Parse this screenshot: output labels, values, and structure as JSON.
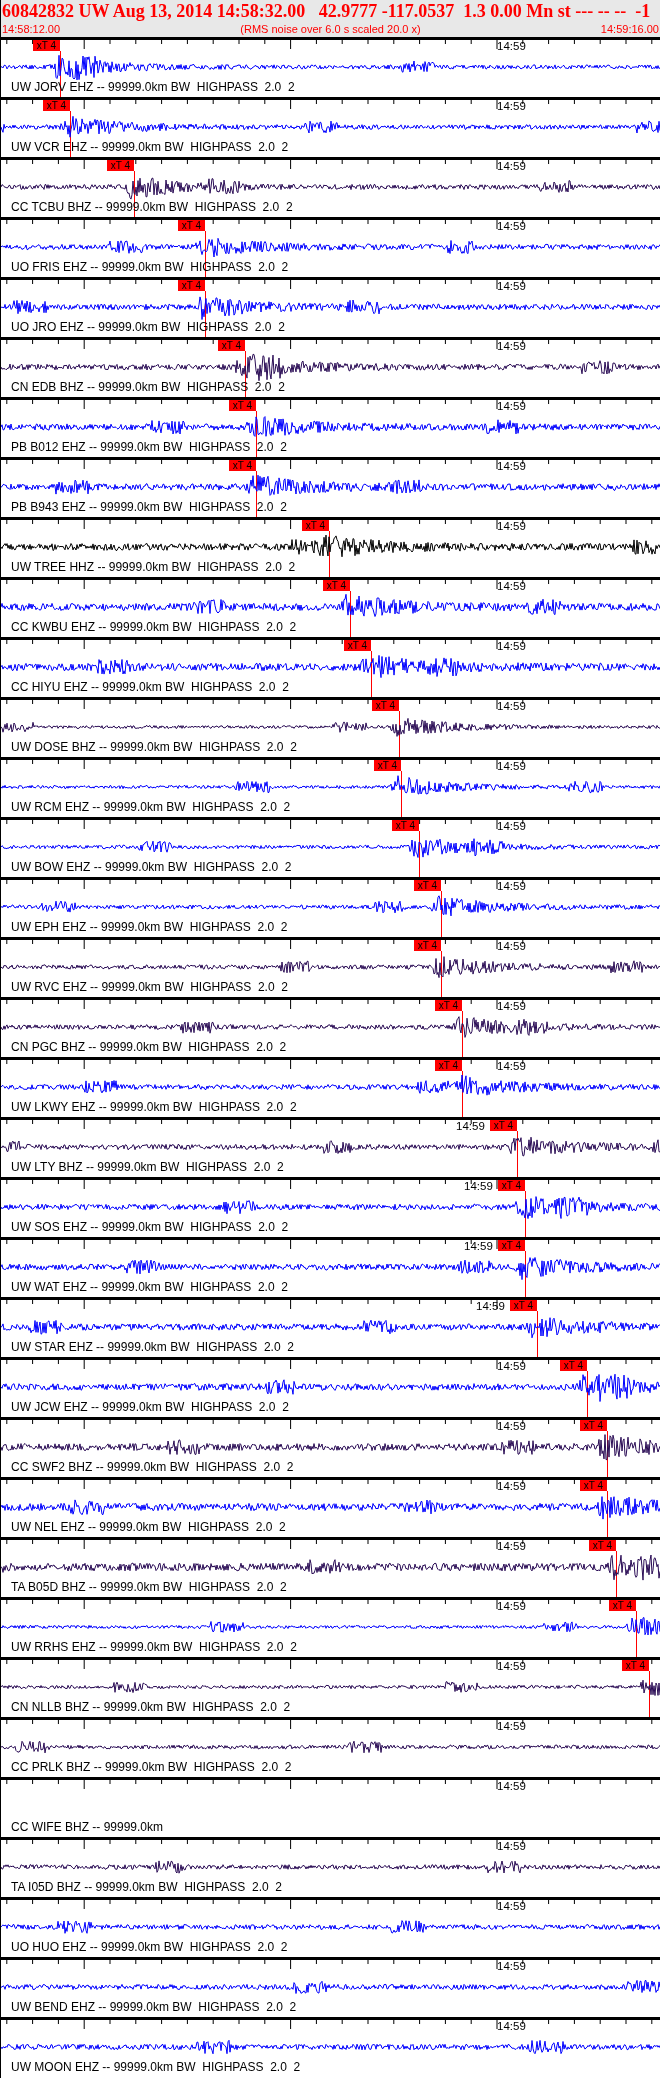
{
  "header": {
    "title": "60842832 UW Aug 13, 2014 14:58:32.00   42.9777 -117.0537  1.3 0.00 Mn st --- -- --  -1",
    "start_time": "14:58:12.00",
    "note": "(RMS noise over 6.0 s scaled 20.0 x)",
    "end_time": "14:59:16.00"
  },
  "traces": [
    {
      "label": "UW JORV EHZ -- 99999.0km BW  HIGHPASS  2.0  2",
      "time_mark": "14:59",
      "color": "#0000ff",
      "pick": {
        "label": "xT 4"
      }
    },
    {
      "label": "UW VCR EHZ -- 99999.0km BW  HIGHPASS  2.0  2",
      "time_mark": "14:59",
      "color": "#0000ff",
      "pick": {
        "label": "xT 4"
      }
    },
    {
      "label": "CC TCBU BHZ -- 99999.0km BW  HIGHPASS  2.0  2",
      "time_mark": "14:59",
      "color": "#2a0c55",
      "pick": {
        "label": "xT 4"
      }
    },
    {
      "label": "UO FRIS EHZ -- 99999.0km BW  HIGHPASS  2.0  2",
      "time_mark": "14:59",
      "color": "#0000ff",
      "pick": {
        "label": "xT 4"
      }
    },
    {
      "label": "UO JRO EHZ -- 99999.0km BW  HIGHPASS  2.0  2",
      "time_mark": "14:59",
      "color": "#0000ff",
      "pick": {
        "label": "xT 4"
      }
    },
    {
      "label": "CN EDB BHZ -- 99999.0km BW  HIGHPASS  2.0  2",
      "time_mark": "14:59",
      "color": "#2a0c55",
      "pick": {
        "label": "xT 4"
      }
    },
    {
      "label": "PB B012 EHZ -- 99999.0km BW  HIGHPASS  2.0  2",
      "time_mark": "14:59",
      "color": "#0000ff",
      "pick": {
        "label": "xT 4"
      }
    },
    {
      "label": "PB B943 EHZ -- 99999.0km BW  HIGHPASS  2.0  2",
      "time_mark": "14:59",
      "color": "#0000ff",
      "pick": {
        "label": "xT 4"
      }
    },
    {
      "label": "UW TREE HHZ -- 99999.0km BW  HIGHPASS  2.0  2",
      "time_mark": "14:59",
      "color": "#000000",
      "pick": {
        "label": "xT 4"
      }
    },
    {
      "label": "CC KWBU EHZ -- 99999.0km BW  HIGHPASS  2.0  2",
      "time_mark": "14:59",
      "color": "#0000ff",
      "pick": {
        "label": "xT 4"
      }
    },
    {
      "label": "CC HIYU EHZ -- 99999.0km BW  HIGHPASS  2.0  2",
      "time_mark": "14:59",
      "color": "#0000ff",
      "pick": {
        "label": "xT 4"
      }
    },
    {
      "label": "UW DOSE BHZ -- 99999.0km BW  HIGHPASS  2.0  2",
      "time_mark": "14:59",
      "color": "#2a0c55",
      "pick": {
        "label": "xT 4"
      }
    },
    {
      "label": "UW RCM EHZ -- 99999.0km BW  HIGHPASS  2.0  2",
      "time_mark": "14:59",
      "color": "#0000ff",
      "pick": {
        "label": "xT 4"
      }
    },
    {
      "label": "UW BOW EHZ -- 99999.0km BW  HIGHPASS  2.0  2",
      "time_mark": "14:59",
      "color": "#0000ff",
      "pick": {
        "label": "xT 4"
      }
    },
    {
      "label": "UW EPH EHZ -- 99999.0km BW  HIGHPASS  2.0  2",
      "time_mark": "14:59",
      "color": "#0000ff",
      "pick": {
        "label": "xT 4"
      }
    },
    {
      "label": "UW RVC EHZ -- 99999.0km BW  HIGHPASS  2.0  2",
      "time_mark": "14:59",
      "color": "#2a0c55",
      "pick": {
        "label": "xT 4"
      }
    },
    {
      "label": "CN PGC BHZ -- 99999.0km BW  HIGHPASS  2.0  2",
      "time_mark": "14:59",
      "color": "#2a0c55",
      "pick": {
        "label": "xT 4"
      }
    },
    {
      "label": "UW LKWY EHZ -- 99999.0km BW  HIGHPASS  2.0  2",
      "time_mark": "14:59",
      "color": "#0000ff",
      "pick": {
        "label": "xT 4"
      }
    },
    {
      "label": "UW LTY BHZ -- 99999.0km BW  HIGHPASS  2.0  2",
      "time_mark": "14:59",
      "color": "#2a0c55",
      "pick": {
        "label": "xT 4"
      }
    },
    {
      "label": "UW SOS EHZ -- 99999.0km BW  HIGHPASS  2.0  2",
      "time_mark": "14:59",
      "color": "#0000ff",
      "pick": {
        "label": "xT 4"
      }
    },
    {
      "label": "UW WAT EHZ -- 99999.0km BW  HIGHPASS  2.0  2",
      "time_mark": "14:59",
      "color": "#0000ff",
      "pick": {
        "label": "xT 4"
      }
    },
    {
      "label": "UW STAR EHZ -- 99999.0km BW  HIGHPASS  2.0  2",
      "time_mark": "14:59",
      "color": "#0000ff",
      "pick": {
        "label": "xT 4"
      }
    },
    {
      "label": "UW JCW EHZ -- 99999.0km BW  HIGHPASS  2.0  2",
      "time_mark": "14:59",
      "color": "#0000ff",
      "pick": {
        "label": "xT 4"
      }
    },
    {
      "label": "CC SWF2 BHZ -- 99999.0km BW  HIGHPASS  2.0  2",
      "time_mark": "14:59",
      "color": "#2a0c55",
      "pick": {
        "label": "xT 4"
      }
    },
    {
      "label": "UW NEL EHZ -- 99999.0km BW  HIGHPASS  2.0  2",
      "time_mark": "14:59",
      "color": "#0000ff",
      "pick": {
        "label": "xT 4"
      }
    },
    {
      "label": "TA B05D BHZ -- 99999.0km BW  HIGHPASS  2.0  2",
      "time_mark": "14:59",
      "color": "#2a0c55",
      "pick": {
        "label": "xT 4"
      }
    },
    {
      "label": "UW RRHS EHZ -- 99999.0km BW  HIGHPASS  2.0  2",
      "time_mark": "14:59",
      "color": "#0000ff",
      "pick": {
        "label": "xT 4"
      }
    },
    {
      "label": "CN NLLB BHZ -- 99999.0km BW  HIGHPASS  2.0  2",
      "time_mark": "14:59",
      "color": "#2a0c55",
      "pick": {
        "label": "xT 4"
      }
    },
    {
      "label": "CC PRLK BHZ -- 99999.0km BW  HIGHPASS  2.0  2",
      "time_mark": "14:59",
      "color": "#2a0c55"
    },
    {
      "label": "CC WIFE BHZ -- 99999.0km",
      "time_mark": "14:59"
    },
    {
      "label": "TA I05D BHZ -- 99999.0km BW  HIGHPASS  2.0  2",
      "time_mark": "14:59",
      "color": "#2a0c55"
    },
    {
      "label": "UO HUO EHZ -- 99999.0km BW  HIGHPASS  2.0  2",
      "time_mark": "14:59",
      "color": "#0000ff"
    },
    {
      "label": "UW BEND EHZ -- 99999.0km BW  HIGHPASS  2.0  2",
      "time_mark": "14:59",
      "color": "#0000ff"
    },
    {
      "label": "UW MOON EHZ -- 99999.0km BW  HIGHPASS  2.0  2",
      "time_mark": "14:59",
      "color": "#0000ff"
    }
  ]
}
